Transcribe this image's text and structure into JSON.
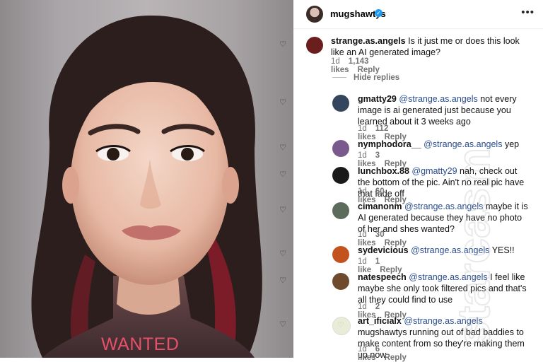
{
  "photo": {
    "overlay_text": "WANTED",
    "overlay_color": "#e8506a"
  },
  "post": {
    "author": "mugshawtys",
    "verified": true,
    "more_icon": "more-horizontal-icon"
  },
  "comments": [
    {
      "user": "strange.as.angels",
      "text": "Is it just me or does this look like an AI generated image?",
      "mention": "",
      "time": "1d",
      "likes": "1,143 likes",
      "reply": "Reply",
      "avatar_color": "#6b1e1e"
    },
    {
      "user": "gmatty29",
      "mention": "@strange.as.angels",
      "text": "not every image is ai generated just because you learned about it 3 weeks ago",
      "time": "1d",
      "likes": "112 likes",
      "reply": "Reply",
      "avatar_color": "#33465e"
    },
    {
      "user": "nymphodora__",
      "mention": "@strange.as.angels",
      "text": "yep",
      "time": "1d",
      "likes": "3 likes",
      "reply": "Reply",
      "avatar_color": "#7a5a8c"
    },
    {
      "user": "lunchbox.88",
      "mention": "@gmatty29",
      "text": "nah, check out the bottom of the pic. Ain't no real pic have that fade off",
      "time": "1d",
      "likes": "60 likes",
      "reply": "Reply",
      "avatar_color": "#1a1a1a"
    },
    {
      "user": "cimanonm",
      "mention": "@strange.as.angels",
      "text": "maybe it is AI generated because they have no photo of her and shes wanted?",
      "time": "1d",
      "likes": "30 likes",
      "reply": "Reply",
      "avatar_color": "#5b6b5c"
    },
    {
      "user": "sydevicious",
      "mention": "@strange.as.angels",
      "text": "YES!!",
      "time": "1d",
      "likes": "1 like",
      "reply": "Reply",
      "avatar_color": "#c2531f"
    },
    {
      "user": "natespeech",
      "mention": "@strange.as.angels",
      "text": "I feel like maybe she only took filtered pics and that's all they could find to use",
      "time": "1d",
      "likes": "2 likes",
      "reply": "Reply",
      "avatar_color": "#6e4b2f"
    },
    {
      "user": "art_ificialx",
      "mention": "@strange.as.angels",
      "text": "mugshawtys running out of bad baddies to make content from so they're making them up now",
      "time": "1d",
      "likes": "6 likes",
      "reply": "Reply",
      "avatar_color": "#e9edd8"
    }
  ],
  "hide_replies": "Hide replies",
  "watermark": "starcasm"
}
